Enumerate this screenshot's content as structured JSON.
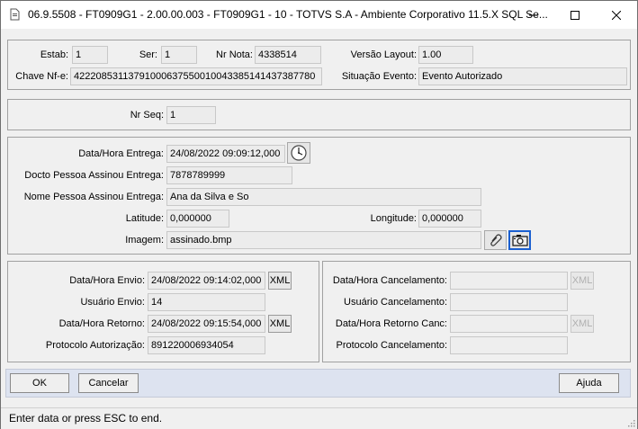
{
  "window": {
    "title": "06.9.5508 - FT0909G1 - 2.00.00.003 - FT0909G1 - 10 - TOTVS S.A - Ambiente Corporativo 11.5.X SQL Se...",
    "minimize_icon": "minimize-icon",
    "maximize_icon": "maximize-icon",
    "close_icon": "close-icon"
  },
  "header": {
    "estab_label": "Estab:",
    "estab_value": "1",
    "ser_label": "Ser:",
    "ser_value": "1",
    "nr_nota_label": "Nr Nota:",
    "nr_nota_value": "4338514",
    "versao_label": "Versão Layout:",
    "versao_value": "1.00",
    "chave_label": "Chave Nf-e:",
    "chave_value": "42220853113791000637550010043385141437387780",
    "situacao_label": "Situação Evento:",
    "situacao_value": "Evento Autorizado"
  },
  "seq": {
    "label": "Nr Seq:",
    "value": "1"
  },
  "entrega": {
    "data_label": "Data/Hora Entrega:",
    "data_value": "24/08/2022 09:09:12,000",
    "docto_label": "Docto Pessoa Assinou Entrega:",
    "docto_value": "7878789999",
    "nome_label": "Nome Pessoa Assinou Entrega:",
    "nome_value": "Ana da Silva e So",
    "latitude_label": "Latitude:",
    "latitude_value": "0,000000",
    "longitude_label": "Longitude:",
    "longitude_value": "0,000000",
    "imagem_label": "Imagem:",
    "imagem_value": "assinado.bmp"
  },
  "envio": {
    "data_envio_label": "Data/Hora Envio:",
    "data_envio_value": "24/08/2022 09:14:02,000",
    "usuario_envio_label": "Usuário Envio:",
    "usuario_envio_value": "14",
    "data_retorno_label": "Data/Hora Retorno:",
    "data_retorno_value": "24/08/2022 09:15:54,000",
    "protocolo_label": "Protocolo Autorização:",
    "protocolo_value": "891220006934054",
    "xml_label": "XML"
  },
  "cancelamento": {
    "data_label": "Data/Hora Cancelamento:",
    "data_value": "",
    "usuario_label": "Usuário Cancelamento:",
    "usuario_value": "",
    "retorno_label": "Data/Hora Retorno Canc:",
    "retorno_value": "",
    "protocolo_label": "Protocolo Cancelamento:",
    "protocolo_value": "",
    "xml_label": "XML"
  },
  "buttons": {
    "ok": "OK",
    "cancelar": "Cancelar",
    "ajuda": "Ajuda"
  },
  "status_bar": {
    "text": "Enter data or press ESC to end."
  }
}
